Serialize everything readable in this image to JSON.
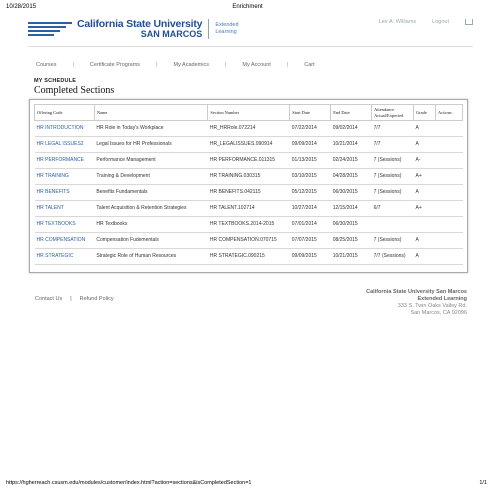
{
  "print_header": {
    "date": "10/28/2015",
    "title": "Enrichment"
  },
  "logo": {
    "university": "California State University",
    "campus": "SAN MARCOS",
    "ext_line1": "Extended",
    "ext_line2": "Learning"
  },
  "user": {
    "name": "Lee A. Williams",
    "logout": "Logout",
    "cart_icon": "cart-icon"
  },
  "nav": {
    "items": [
      "Courses",
      "Certificate Programs",
      "My Academics",
      "My Account",
      "Cart"
    ],
    "separator": "|"
  },
  "section_label": "MY SCHEDULE",
  "page_title": "Completed Sections",
  "table": {
    "headers": [
      "Offering Code",
      "Name",
      "Section Number",
      "Start Date",
      "End Date",
      "Attendance Actual/Expected",
      "Grade",
      "Actions"
    ],
    "rows": [
      [
        "HR INTRODUCTION",
        "HR Role in Today's Workplace",
        "HR_HRRole.072214",
        "07/22/2014",
        "09/02/2014",
        "7/7",
        "A",
        ""
      ],
      [
        "HR LEGAL ISSUES2",
        "Legal Issues for HR Professionals",
        "HR_LEGALISSUES.090914",
        "09/09/2014",
        "10/21/2014",
        "7/7",
        "A",
        ""
      ],
      [
        "HR PERFORMANCE",
        "Performance Management",
        "HR PERFORMANCE.011315",
        "01/13/2015",
        "02/24/2015",
        "7 (Sessions)",
        "A-",
        ""
      ],
      [
        "HR TRAINING",
        "Training & Development",
        "HR TRAINING.030315",
        "03/10/2015",
        "04/28/2015",
        "7 (Sessions)",
        "A+",
        ""
      ],
      [
        "HR BENEFITS",
        "Benefits Fundamentals",
        "HR BENEFITS.042115",
        "05/12/2015",
        "06/30/2015",
        "7 (Sessions)",
        "A",
        ""
      ],
      [
        "HR TALENT",
        "Talent Acquisition & Retention Strategies",
        "HR TALENT.102714",
        "10/27/2014",
        "12/15/2014",
        "6/7",
        "A+",
        ""
      ],
      [
        "HR TEXTBOOKS",
        "HR Textbooks",
        "HR TEXTBOOKS.2014-2015",
        "07/01/2014",
        "06/30/2015",
        "",
        "",
        ""
      ],
      [
        "HR COMPENSATION",
        "Compensation Fudementals",
        "HR COMPENSATION.070715",
        "07/07/2015",
        "08/25/2015",
        "7 (Sessions)",
        "A",
        ""
      ],
      [
        "HR STRATEGIC",
        "Strategic Role of Human Resources",
        "HR STRATEGIC.090215",
        "09/09/2015",
        "10/21/2015",
        "7/7 (Sessions)",
        "A",
        ""
      ]
    ]
  },
  "footer": {
    "links": [
      "Contact Us",
      "Refund Policy"
    ],
    "separator": "|",
    "address": [
      "California State University San Marcos",
      "Extended Learning",
      "333 S. Twin Oaks Valley Rd.",
      "San Marcos, CA 92096"
    ]
  },
  "print_footer": {
    "url": "https://hgherreach.csusm.edu/modules/customer/index.html?action=sections&isCompletedSection=1",
    "page": "1/1"
  },
  "colors": {
    "brand": "#1f4f96",
    "link": "#2b5fa8"
  }
}
